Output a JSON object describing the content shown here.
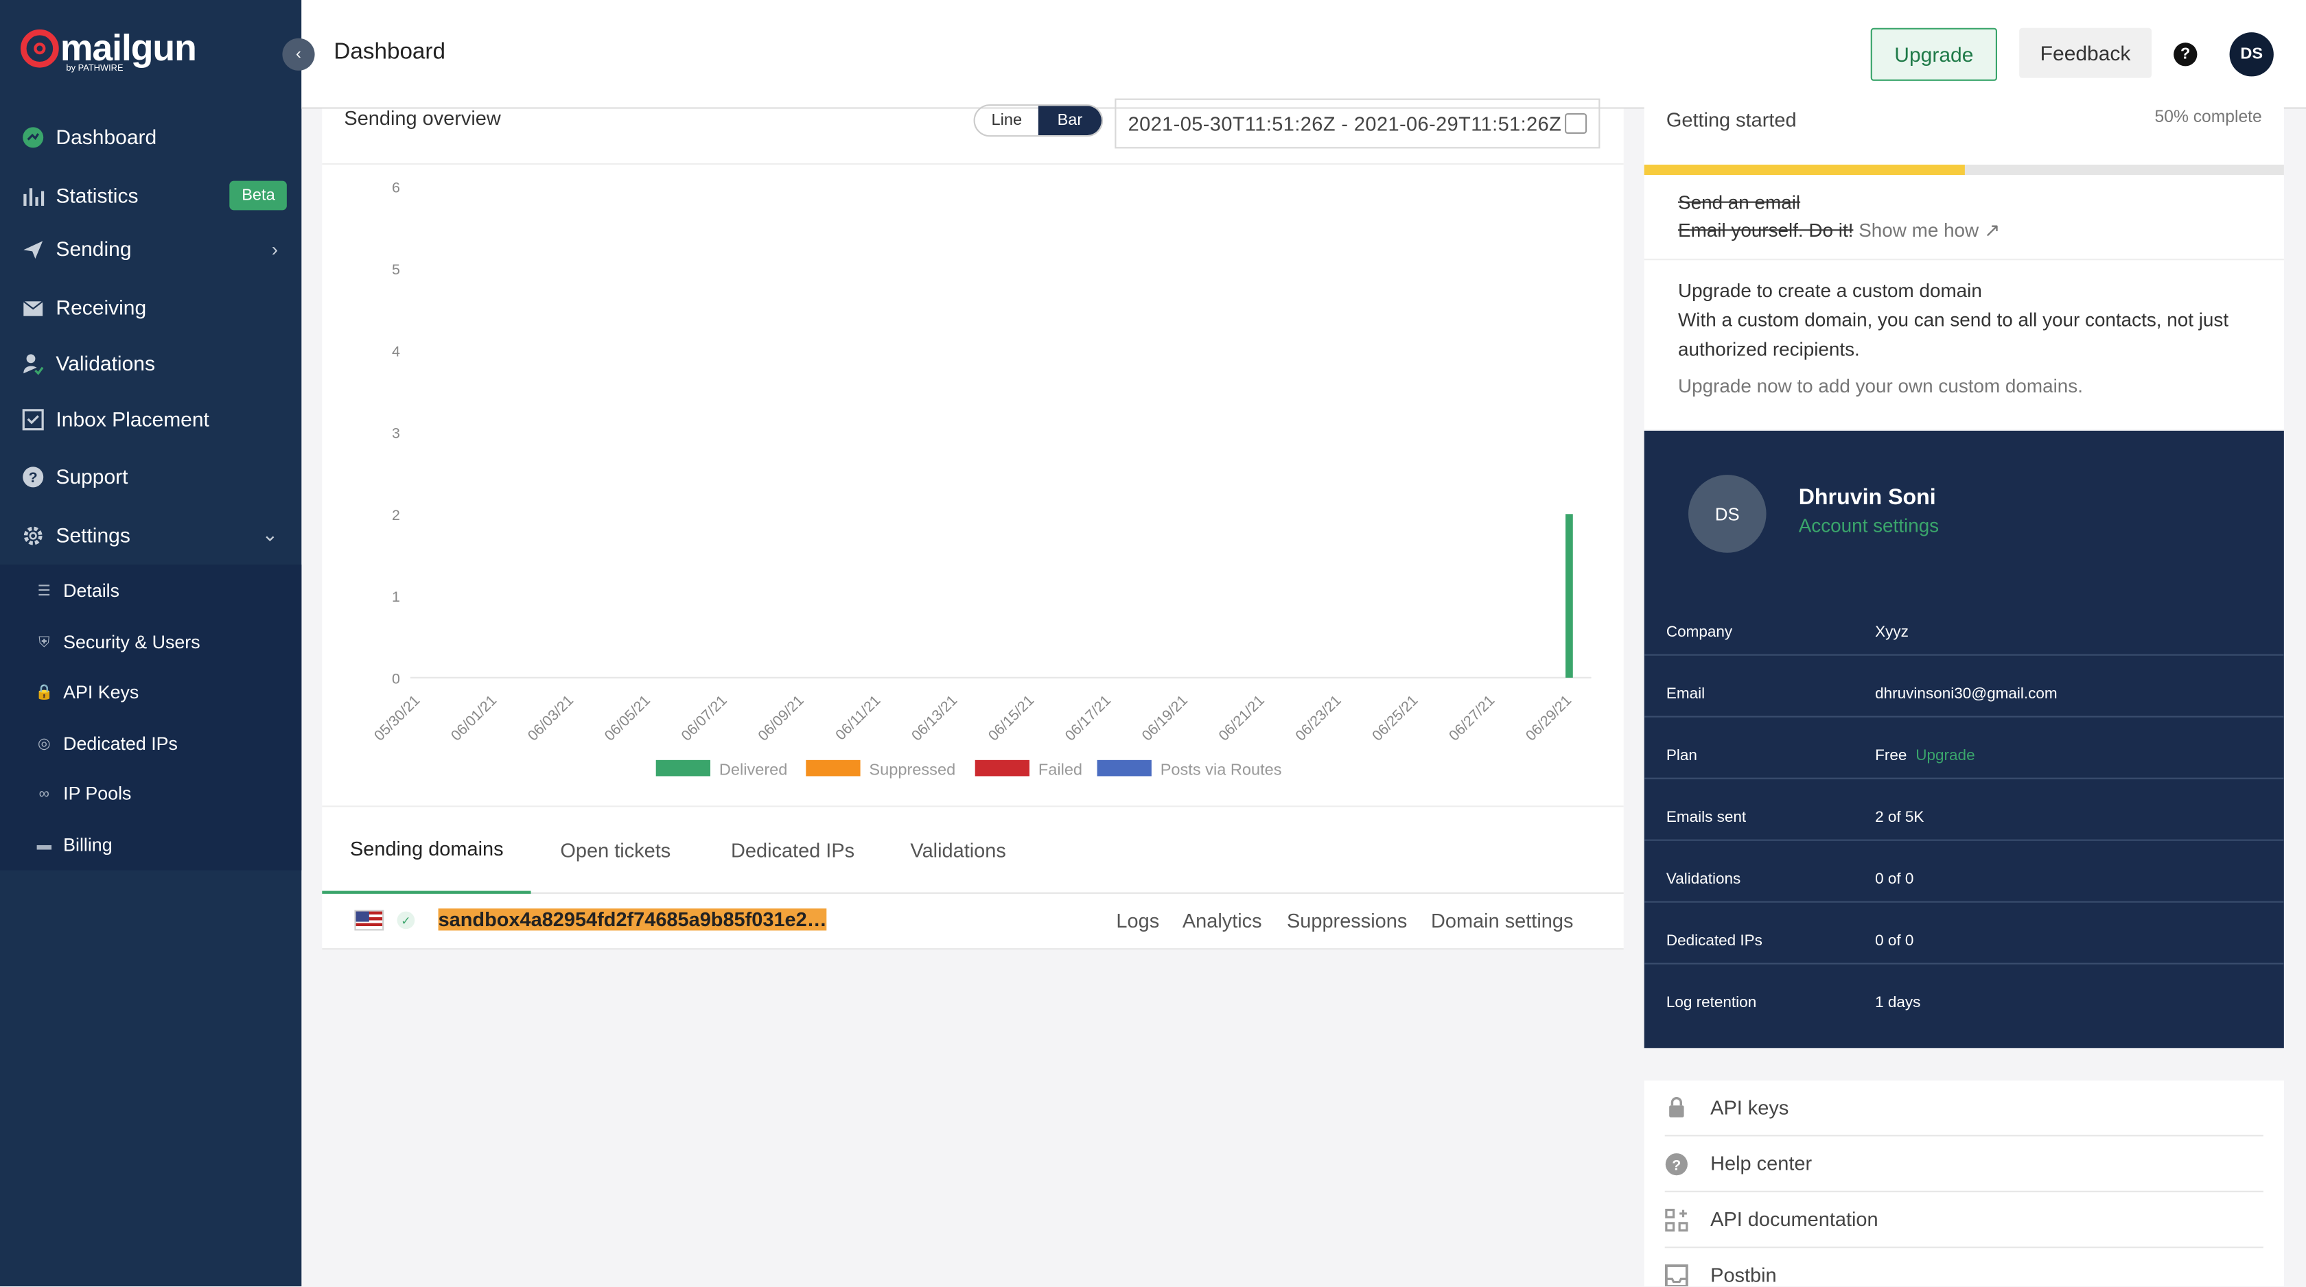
{
  "brand": {
    "logo_text": "mailgun",
    "logo_sub": "by PATHWIRE"
  },
  "sidebar": {
    "items": [
      {
        "label": "Dashboard",
        "icon": "dashboard-icon"
      },
      {
        "label": "Statistics",
        "icon": "statistics-icon",
        "badge": "Beta"
      },
      {
        "label": "Sending",
        "icon": "sending-icon"
      },
      {
        "label": "Receiving",
        "icon": "receiving-icon"
      },
      {
        "label": "Validations",
        "icon": "validations-icon"
      },
      {
        "label": "Inbox Placement",
        "icon": "inbox-placement-icon"
      },
      {
        "label": "Support",
        "icon": "support-icon"
      },
      {
        "label": "Settings",
        "icon": "settings-icon"
      }
    ],
    "settings_sub": [
      {
        "label": "Details"
      },
      {
        "label": "Security & Users"
      },
      {
        "label": "API Keys"
      },
      {
        "label": "Dedicated IPs"
      },
      {
        "label": "IP Pools"
      },
      {
        "label": "Billing"
      }
    ]
  },
  "header": {
    "title": "Dashboard",
    "upgrade": "Upgrade",
    "feedback": "Feedback",
    "help": "?",
    "avatar": "DS"
  },
  "overview": {
    "title": "Sending overview",
    "toggle": {
      "line": "Line",
      "bar": "Bar",
      "selected": "Bar"
    },
    "date_range": "2021-05-30T11:51:26Z - 2021-06-29T11:51:26Z"
  },
  "chart_data": {
    "type": "bar",
    "title": "",
    "xlabel": "",
    "ylabel": "",
    "ylim": [
      0,
      6
    ],
    "yticks": [
      0,
      1,
      2,
      3,
      4,
      5,
      6
    ],
    "x_ticks": [
      "05/30/21",
      "06/01/21",
      "06/03/21",
      "06/05/21",
      "06/07/21",
      "06/09/21",
      "06/11/21",
      "06/13/21",
      "06/15/21",
      "06/17/21",
      "06/19/21",
      "06/21/21",
      "06/23/21",
      "06/25/21",
      "06/27/21",
      "06/29/21"
    ],
    "categories": [
      "05/30/21",
      "05/31/21",
      "06/01/21",
      "06/02/21",
      "06/03/21",
      "06/04/21",
      "06/05/21",
      "06/06/21",
      "06/07/21",
      "06/08/21",
      "06/09/21",
      "06/10/21",
      "06/11/21",
      "06/12/21",
      "06/13/21",
      "06/14/21",
      "06/15/21",
      "06/16/21",
      "06/17/21",
      "06/18/21",
      "06/19/21",
      "06/20/21",
      "06/21/21",
      "06/22/21",
      "06/23/21",
      "06/24/21",
      "06/25/21",
      "06/26/21",
      "06/27/21",
      "06/28/21",
      "06/29/21"
    ],
    "series": [
      {
        "name": "Delivered",
        "color": "#3aa56b",
        "values": [
          0,
          0,
          0,
          0,
          0,
          0,
          0,
          0,
          0,
          0,
          0,
          0,
          0,
          0,
          0,
          0,
          0,
          0,
          0,
          0,
          0,
          0,
          0,
          0,
          0,
          0,
          0,
          0,
          0,
          0,
          2
        ]
      },
      {
        "name": "Suppressed",
        "color": "#f5901e",
        "values": [
          0,
          0,
          0,
          0,
          0,
          0,
          0,
          0,
          0,
          0,
          0,
          0,
          0,
          0,
          0,
          0,
          0,
          0,
          0,
          0,
          0,
          0,
          0,
          0,
          0,
          0,
          0,
          0,
          0,
          0,
          0
        ]
      },
      {
        "name": "Failed",
        "color": "#cc2a2f",
        "values": [
          0,
          0,
          0,
          0,
          0,
          0,
          0,
          0,
          0,
          0,
          0,
          0,
          0,
          0,
          0,
          0,
          0,
          0,
          0,
          0,
          0,
          0,
          0,
          0,
          0,
          0,
          0,
          0,
          0,
          0,
          0
        ]
      },
      {
        "name": "Posts via Routes",
        "color": "#4a6cc0",
        "values": [
          0,
          0,
          0,
          0,
          0,
          0,
          0,
          0,
          0,
          0,
          0,
          0,
          0,
          0,
          0,
          0,
          0,
          0,
          0,
          0,
          0,
          0,
          0,
          0,
          0,
          0,
          0,
          0,
          0,
          0,
          0
        ]
      }
    ],
    "legend_placement": "bottom"
  },
  "tabs": [
    {
      "label": "Sending domains"
    },
    {
      "label": "Open tickets"
    },
    {
      "label": "Dedicated IPs"
    },
    {
      "label": "Validations"
    }
  ],
  "domains": [
    {
      "name": "sandbox4a82954fd2f74685a9b85f031e2…",
      "verified": true,
      "links": [
        "Logs",
        "Analytics",
        "Suppressions",
        "Domain settings"
      ]
    }
  ],
  "getting_started": {
    "title": "Getting started",
    "progress_label": "50% complete",
    "progress": 0.5,
    "steps": [
      {
        "text": "Send an email",
        "done": true
      },
      {
        "text": "Email yourself. Do it!",
        "done": true,
        "link": "Show me how"
      }
    ],
    "upgrade_title": "Upgrade to create a custom domain",
    "upgrade_body": "With a custom domain, you can send to all your contacts, not just authorized recipients.",
    "upgrade_cta": "Upgrade now to add your own custom domains."
  },
  "account": {
    "avatar": "DS",
    "name": "Dhruvin Soni",
    "settings_link": "Account settings",
    "rows": [
      {
        "label": "Company",
        "value": "Xyyz"
      },
      {
        "label": "Email",
        "value": "dhruvinsoni30@gmail.com"
      },
      {
        "label": "Plan",
        "value": "Free",
        "link": "Upgrade"
      },
      {
        "label": "Emails sent",
        "value": "2 of 5K"
      },
      {
        "label": "Validations",
        "value": "0 of 0"
      },
      {
        "label": "Dedicated IPs",
        "value": "0 of 0"
      },
      {
        "label": "Log retention",
        "value": "1 days"
      }
    ]
  },
  "quick_links": [
    {
      "label": "API keys",
      "icon": "lock-icon"
    },
    {
      "label": "Help center",
      "icon": "help-icon"
    },
    {
      "label": "API documentation",
      "icon": "grid-icon"
    },
    {
      "label": "Postbin",
      "icon": "inbox-icon"
    }
  ],
  "colors": {
    "sidebar": "#1a3150",
    "accent": "#3aa56b",
    "brand_red": "#e8323a",
    "account_card": "#1a2c4d",
    "progress": "#f7cb3d"
  }
}
